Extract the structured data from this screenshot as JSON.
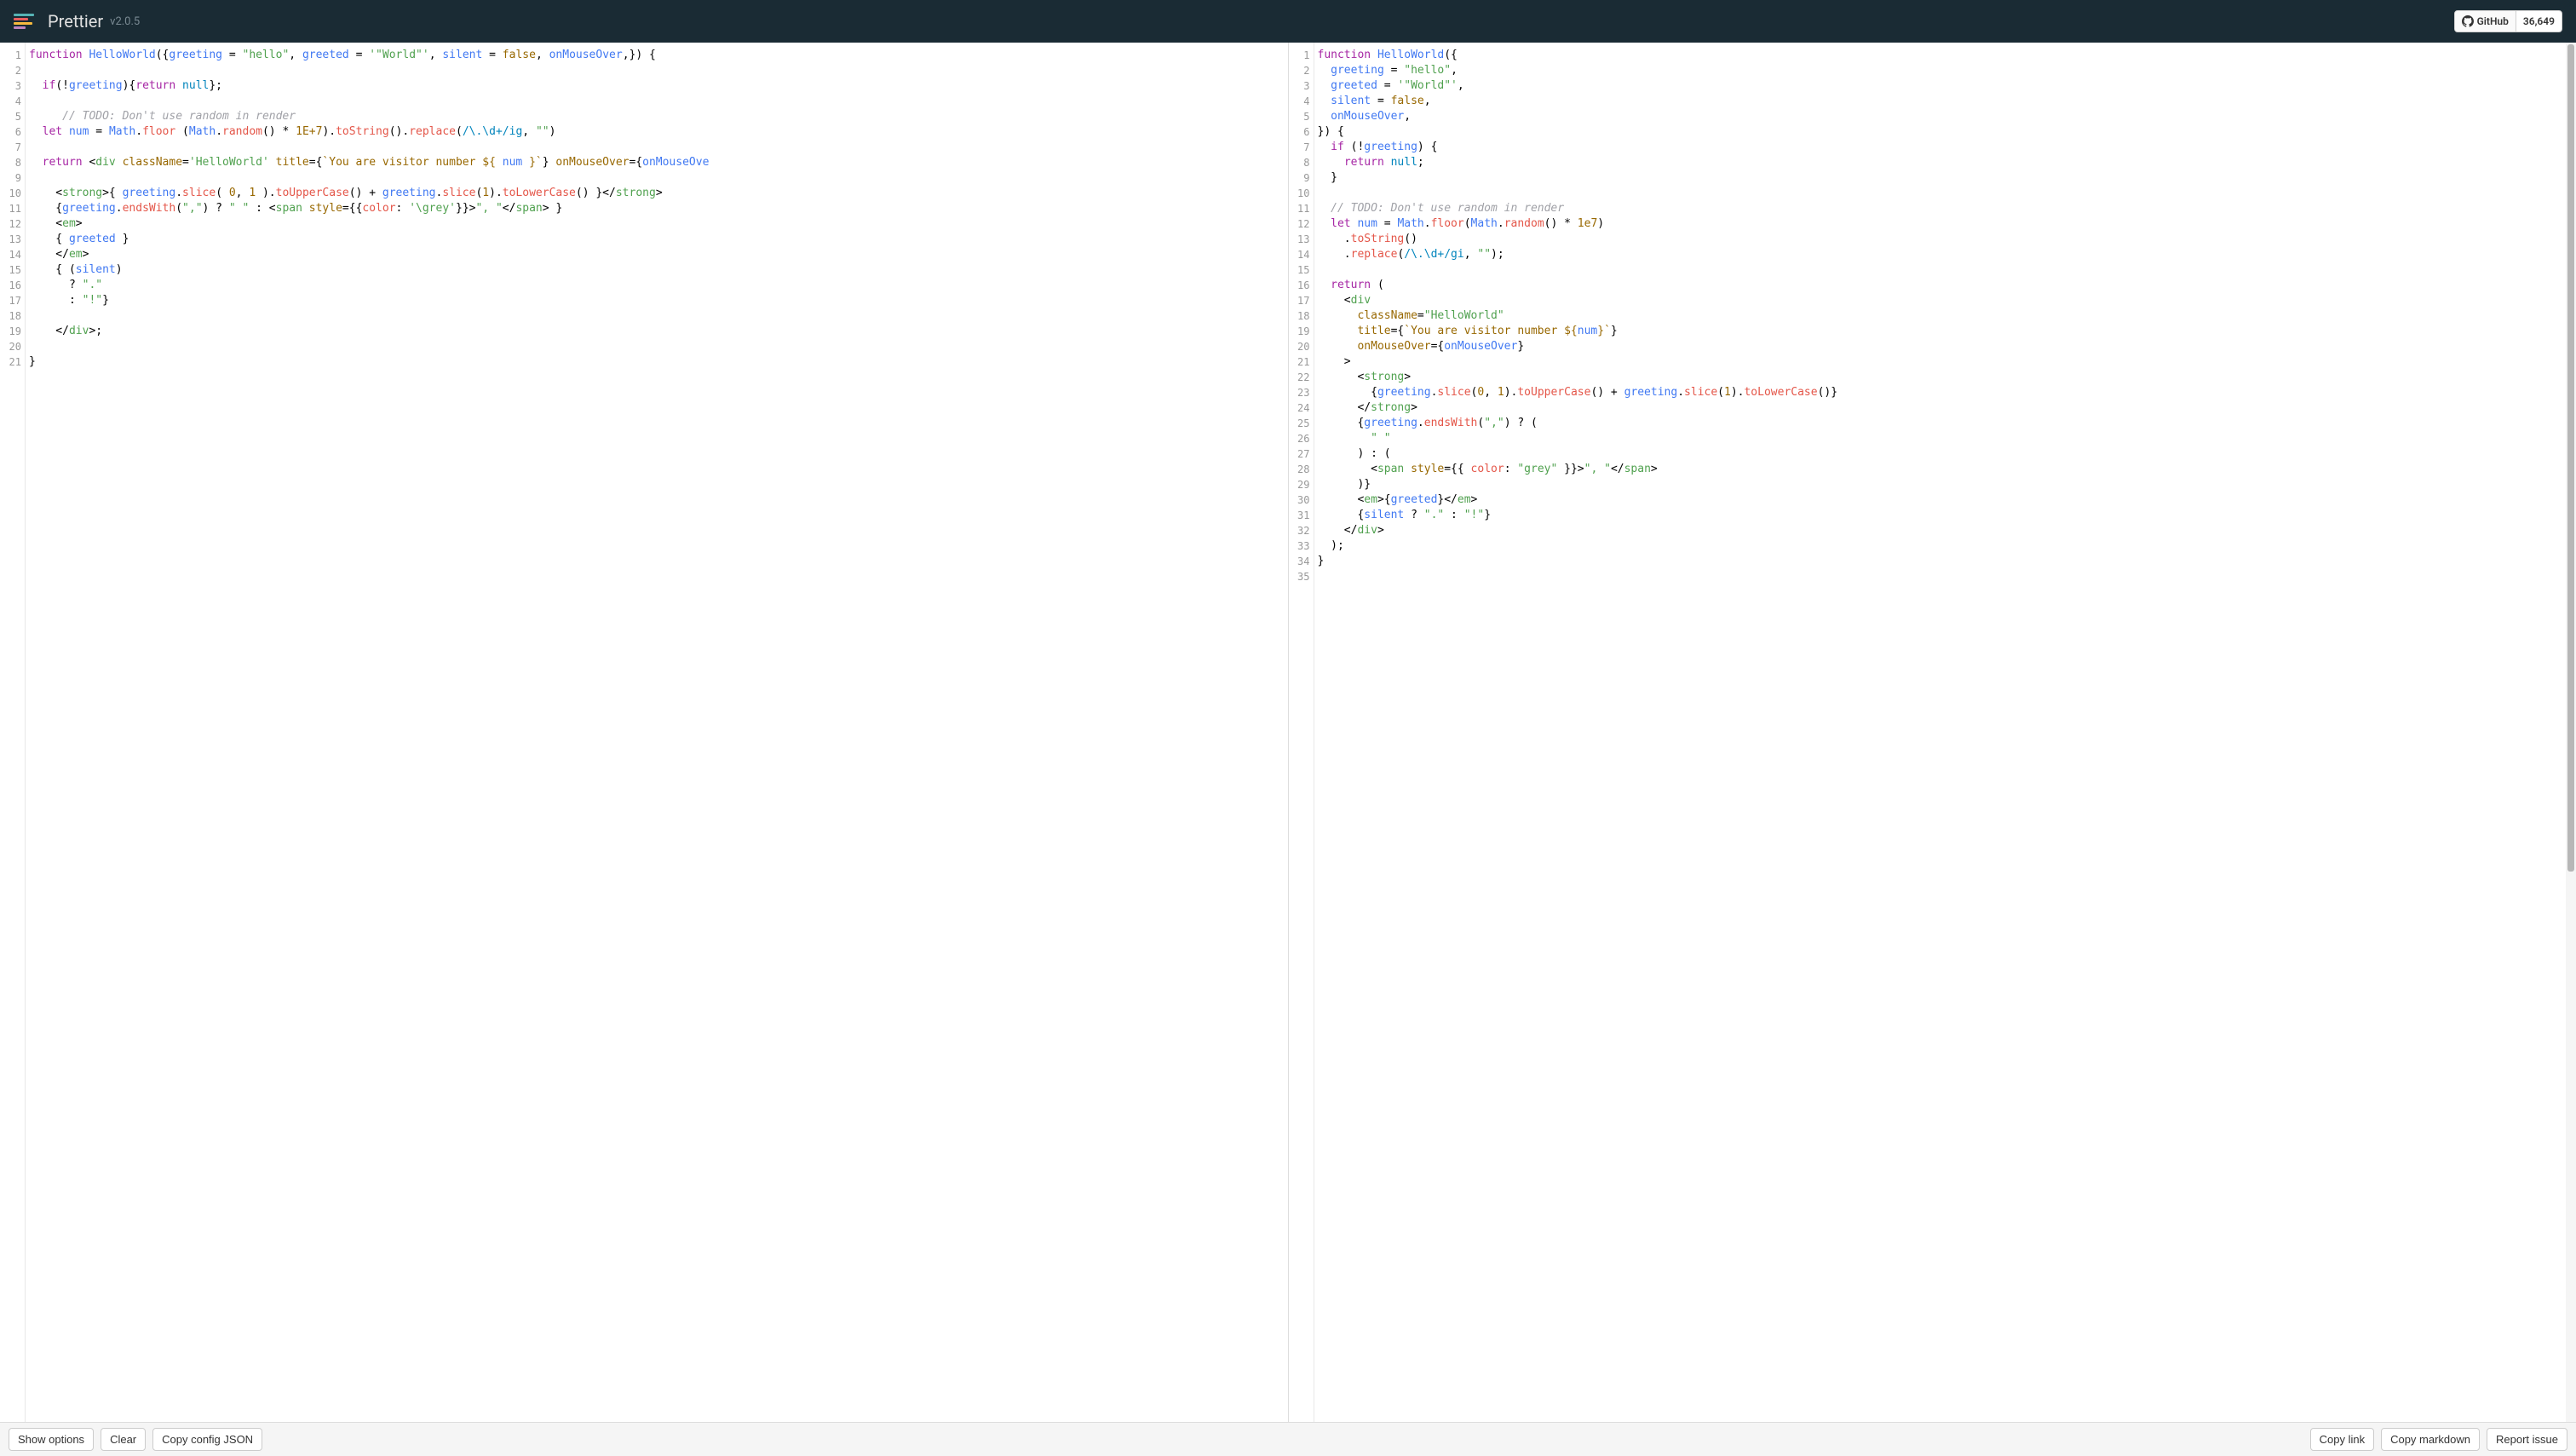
{
  "header": {
    "title": "Prettier",
    "version": "v2.0.5",
    "github_label": "GitHub",
    "github_stars": "36,649"
  },
  "editor": {
    "left_lines": 21,
    "right_lines": 35,
    "left_code": [
      [
        {
          "t": "function ",
          "c": "kw"
        },
        {
          "t": "HelloWorld",
          "c": "fn"
        },
        {
          "t": "({",
          "c": ""
        },
        {
          "t": "greeting",
          "c": "def"
        },
        {
          "t": " = ",
          "c": ""
        },
        {
          "t": "\"hello\"",
          "c": "str"
        },
        {
          "t": ", ",
          "c": ""
        },
        {
          "t": "greeted",
          "c": "def"
        },
        {
          "t": " = ",
          "c": ""
        },
        {
          "t": "'\"World\"'",
          "c": "str"
        },
        {
          "t": ", ",
          "c": ""
        },
        {
          "t": "silent",
          "c": "def"
        },
        {
          "t": " = ",
          "c": ""
        },
        {
          "t": "false",
          "c": "bool"
        },
        {
          "t": ", ",
          "c": ""
        },
        {
          "t": "onMouseOver",
          "c": "def"
        },
        {
          "t": ",}) {",
          "c": ""
        }
      ],
      [],
      [
        {
          "t": "  ",
          "c": ""
        },
        {
          "t": "if",
          "c": "kw"
        },
        {
          "t": "(!",
          "c": ""
        },
        {
          "t": "greeting",
          "c": "var2"
        },
        {
          "t": "){",
          "c": ""
        },
        {
          "t": "return ",
          "c": "kw"
        },
        {
          "t": "null",
          "c": "null"
        },
        {
          "t": "};",
          "c": ""
        }
      ],
      [],
      [
        {
          "t": "     ",
          "c": ""
        },
        {
          "t": "// TODO: Don't use random in render",
          "c": "com"
        }
      ],
      [
        {
          "t": "  ",
          "c": ""
        },
        {
          "t": "let ",
          "c": "kw"
        },
        {
          "t": "num",
          "c": "def"
        },
        {
          "t": " = ",
          "c": ""
        },
        {
          "t": "Math",
          "c": "var2"
        },
        {
          "t": ".",
          "c": ""
        },
        {
          "t": "floor",
          "c": "prop"
        },
        {
          "t": " (",
          "c": ""
        },
        {
          "t": "Math",
          "c": "var2"
        },
        {
          "t": ".",
          "c": ""
        },
        {
          "t": "random",
          "c": "prop"
        },
        {
          "t": "() * ",
          "c": ""
        },
        {
          "t": "1E+7",
          "c": "num"
        },
        {
          "t": ").",
          "c": ""
        },
        {
          "t": "toString",
          "c": "prop"
        },
        {
          "t": "().",
          "c": ""
        },
        {
          "t": "replace",
          "c": "prop"
        },
        {
          "t": "(",
          "c": ""
        },
        {
          "t": "/\\.\\d+/ig",
          "c": "reg"
        },
        {
          "t": ", ",
          "c": ""
        },
        {
          "t": "\"\"",
          "c": "str"
        },
        {
          "t": ")",
          "c": ""
        }
      ],
      [],
      [
        {
          "t": "  ",
          "c": ""
        },
        {
          "t": "return ",
          "c": "kw"
        },
        {
          "t": "<",
          "c": ""
        },
        {
          "t": "div",
          "c": "tag"
        },
        {
          "t": " ",
          "c": ""
        },
        {
          "t": "className",
          "c": "attr"
        },
        {
          "t": "=",
          "c": ""
        },
        {
          "t": "'HelloWorld'",
          "c": "str"
        },
        {
          "t": " ",
          "c": ""
        },
        {
          "t": "title",
          "c": "attr"
        },
        {
          "t": "={",
          "c": ""
        },
        {
          "t": "`You are visitor number ${",
          "c": "str2"
        },
        {
          "t": " num ",
          "c": "var2"
        },
        {
          "t": "}`",
          "c": "str2"
        },
        {
          "t": "} ",
          "c": ""
        },
        {
          "t": "onMouseOver",
          "c": "attr"
        },
        {
          "t": "={",
          "c": ""
        },
        {
          "t": "onMouseOve",
          "c": "var2"
        }
      ],
      [],
      [
        {
          "t": "    <",
          "c": ""
        },
        {
          "t": "strong",
          "c": "tag"
        },
        {
          "t": ">{ ",
          "c": ""
        },
        {
          "t": "greeting",
          "c": "var2"
        },
        {
          "t": ".",
          "c": ""
        },
        {
          "t": "slice",
          "c": "prop"
        },
        {
          "t": "( ",
          "c": ""
        },
        {
          "t": "0",
          "c": "num"
        },
        {
          "t": ", ",
          "c": ""
        },
        {
          "t": "1",
          "c": "num"
        },
        {
          "t": " ).",
          "c": ""
        },
        {
          "t": "toUpperCase",
          "c": "prop"
        },
        {
          "t": "() + ",
          "c": ""
        },
        {
          "t": "greeting",
          "c": "var2"
        },
        {
          "t": ".",
          "c": ""
        },
        {
          "t": "slice",
          "c": "prop"
        },
        {
          "t": "(",
          "c": ""
        },
        {
          "t": "1",
          "c": "num"
        },
        {
          "t": ").",
          "c": ""
        },
        {
          "t": "toLowerCase",
          "c": "prop"
        },
        {
          "t": "() }</",
          "c": ""
        },
        {
          "t": "strong",
          "c": "tag"
        },
        {
          "t": ">",
          "c": ""
        }
      ],
      [
        {
          "t": "    {",
          "c": ""
        },
        {
          "t": "greeting",
          "c": "var2"
        },
        {
          "t": ".",
          "c": ""
        },
        {
          "t": "endsWith",
          "c": "prop"
        },
        {
          "t": "(",
          "c": ""
        },
        {
          "t": "\",\"",
          "c": "str"
        },
        {
          "t": ") ? ",
          "c": ""
        },
        {
          "t": "\" \"",
          "c": "str"
        },
        {
          "t": " : <",
          "c": ""
        },
        {
          "t": "span",
          "c": "tag"
        },
        {
          "t": " ",
          "c": ""
        },
        {
          "t": "style",
          "c": "attr"
        },
        {
          "t": "={{",
          "c": ""
        },
        {
          "t": "color",
          "c": "prop"
        },
        {
          "t": ": ",
          "c": ""
        },
        {
          "t": "'\\grey'",
          "c": "str"
        },
        {
          "t": "}}>",
          "c": ""
        },
        {
          "t": "\", \"",
          "c": "str"
        },
        {
          "t": "</",
          "c": ""
        },
        {
          "t": "span",
          "c": "tag"
        },
        {
          "t": "> }",
          "c": ""
        }
      ],
      [
        {
          "t": "    <",
          "c": ""
        },
        {
          "t": "em",
          "c": "tag"
        },
        {
          "t": ">",
          "c": ""
        }
      ],
      [
        {
          "t": "    { ",
          "c": ""
        },
        {
          "t": "greeted",
          "c": "var2"
        },
        {
          "t": " }",
          "c": ""
        }
      ],
      [
        {
          "t": "    </",
          "c": ""
        },
        {
          "t": "em",
          "c": "tag"
        },
        {
          "t": ">",
          "c": ""
        }
      ],
      [
        {
          "t": "    { (",
          "c": ""
        },
        {
          "t": "silent",
          "c": "var2"
        },
        {
          "t": ")",
          "c": ""
        }
      ],
      [
        {
          "t": "      ? ",
          "c": ""
        },
        {
          "t": "\".\"",
          "c": "str"
        }
      ],
      [
        {
          "t": "      : ",
          "c": ""
        },
        {
          "t": "\"!\"",
          "c": "str"
        },
        {
          "t": "}",
          "c": ""
        }
      ],
      [],
      [
        {
          "t": "    </",
          "c": ""
        },
        {
          "t": "div",
          "c": "tag"
        },
        {
          "t": ">;",
          "c": ""
        }
      ],
      [],
      [
        {
          "t": "}",
          "c": ""
        }
      ]
    ],
    "right_code": [
      [
        {
          "t": "function ",
          "c": "kw"
        },
        {
          "t": "HelloWorld",
          "c": "fn"
        },
        {
          "t": "({",
          "c": ""
        }
      ],
      [
        {
          "t": "  ",
          "c": ""
        },
        {
          "t": "greeting",
          "c": "def"
        },
        {
          "t": " = ",
          "c": ""
        },
        {
          "t": "\"hello\"",
          "c": "str"
        },
        {
          "t": ",",
          "c": ""
        }
      ],
      [
        {
          "t": "  ",
          "c": ""
        },
        {
          "t": "greeted",
          "c": "def"
        },
        {
          "t": " = ",
          "c": ""
        },
        {
          "t": "'\"World\"'",
          "c": "str"
        },
        {
          "t": ",",
          "c": ""
        }
      ],
      [
        {
          "t": "  ",
          "c": ""
        },
        {
          "t": "silent",
          "c": "def"
        },
        {
          "t": " = ",
          "c": ""
        },
        {
          "t": "false",
          "c": "bool"
        },
        {
          "t": ",",
          "c": ""
        }
      ],
      [
        {
          "t": "  ",
          "c": ""
        },
        {
          "t": "onMouseOver",
          "c": "def"
        },
        {
          "t": ",",
          "c": ""
        }
      ],
      [
        {
          "t": "}) {",
          "c": ""
        }
      ],
      [
        {
          "t": "  ",
          "c": ""
        },
        {
          "t": "if ",
          "c": "kw"
        },
        {
          "t": "(!",
          "c": ""
        },
        {
          "t": "greeting",
          "c": "var2"
        },
        {
          "t": ") {",
          "c": ""
        }
      ],
      [
        {
          "t": "    ",
          "c": ""
        },
        {
          "t": "return ",
          "c": "kw"
        },
        {
          "t": "null",
          "c": "null"
        },
        {
          "t": ";",
          "c": ""
        }
      ],
      [
        {
          "t": "  }",
          "c": ""
        }
      ],
      [],
      [
        {
          "t": "  ",
          "c": ""
        },
        {
          "t": "// TODO: Don't use random in render",
          "c": "com"
        }
      ],
      [
        {
          "t": "  ",
          "c": ""
        },
        {
          "t": "let ",
          "c": "kw"
        },
        {
          "t": "num",
          "c": "def"
        },
        {
          "t": " = ",
          "c": ""
        },
        {
          "t": "Math",
          "c": "var2"
        },
        {
          "t": ".",
          "c": ""
        },
        {
          "t": "floor",
          "c": "prop"
        },
        {
          "t": "(",
          "c": ""
        },
        {
          "t": "Math",
          "c": "var2"
        },
        {
          "t": ".",
          "c": ""
        },
        {
          "t": "random",
          "c": "prop"
        },
        {
          "t": "() * ",
          "c": ""
        },
        {
          "t": "1e7",
          "c": "num"
        },
        {
          "t": ")",
          "c": ""
        }
      ],
      [
        {
          "t": "    .",
          "c": ""
        },
        {
          "t": "toString",
          "c": "prop"
        },
        {
          "t": "()",
          "c": ""
        }
      ],
      [
        {
          "t": "    .",
          "c": ""
        },
        {
          "t": "replace",
          "c": "prop"
        },
        {
          "t": "(",
          "c": ""
        },
        {
          "t": "/\\.\\d+/gi",
          "c": "reg"
        },
        {
          "t": ", ",
          "c": ""
        },
        {
          "t": "\"\"",
          "c": "str"
        },
        {
          "t": ");",
          "c": ""
        }
      ],
      [],
      [
        {
          "t": "  ",
          "c": ""
        },
        {
          "t": "return ",
          "c": "kw"
        },
        {
          "t": "(",
          "c": ""
        }
      ],
      [
        {
          "t": "    <",
          "c": ""
        },
        {
          "t": "div",
          "c": "tag"
        }
      ],
      [
        {
          "t": "      ",
          "c": ""
        },
        {
          "t": "className",
          "c": "attr"
        },
        {
          "t": "=",
          "c": ""
        },
        {
          "t": "\"HelloWorld\"",
          "c": "str"
        }
      ],
      [
        {
          "t": "      ",
          "c": ""
        },
        {
          "t": "title",
          "c": "attr"
        },
        {
          "t": "={",
          "c": ""
        },
        {
          "t": "`You are visitor number ${",
          "c": "str2"
        },
        {
          "t": "num",
          "c": "var2"
        },
        {
          "t": "}`",
          "c": "str2"
        },
        {
          "t": "}",
          "c": ""
        }
      ],
      [
        {
          "t": "      ",
          "c": ""
        },
        {
          "t": "onMouseOver",
          "c": "attr"
        },
        {
          "t": "={",
          "c": ""
        },
        {
          "t": "onMouseOver",
          "c": "var2"
        },
        {
          "t": "}",
          "c": ""
        }
      ],
      [
        {
          "t": "    >",
          "c": ""
        }
      ],
      [
        {
          "t": "      <",
          "c": ""
        },
        {
          "t": "strong",
          "c": "tag"
        },
        {
          "t": ">",
          "c": ""
        }
      ],
      [
        {
          "t": "        {",
          "c": ""
        },
        {
          "t": "greeting",
          "c": "var2"
        },
        {
          "t": ".",
          "c": ""
        },
        {
          "t": "slice",
          "c": "prop"
        },
        {
          "t": "(",
          "c": ""
        },
        {
          "t": "0",
          "c": "num"
        },
        {
          "t": ", ",
          "c": ""
        },
        {
          "t": "1",
          "c": "num"
        },
        {
          "t": ").",
          "c": ""
        },
        {
          "t": "toUpperCase",
          "c": "prop"
        },
        {
          "t": "() + ",
          "c": ""
        },
        {
          "t": "greeting",
          "c": "var2"
        },
        {
          "t": ".",
          "c": ""
        },
        {
          "t": "slice",
          "c": "prop"
        },
        {
          "t": "(",
          "c": ""
        },
        {
          "t": "1",
          "c": "num"
        },
        {
          "t": ").",
          "c": ""
        },
        {
          "t": "toLowerCase",
          "c": "prop"
        },
        {
          "t": "()}",
          "c": ""
        }
      ],
      [
        {
          "t": "      </",
          "c": ""
        },
        {
          "t": "strong",
          "c": "tag"
        },
        {
          "t": ">",
          "c": ""
        }
      ],
      [
        {
          "t": "      {",
          "c": ""
        },
        {
          "t": "greeting",
          "c": "var2"
        },
        {
          "t": ".",
          "c": ""
        },
        {
          "t": "endsWith",
          "c": "prop"
        },
        {
          "t": "(",
          "c": ""
        },
        {
          "t": "\",\"",
          "c": "str"
        },
        {
          "t": ") ? (",
          "c": ""
        }
      ],
      [
        {
          "t": "        ",
          "c": ""
        },
        {
          "t": "\" \"",
          "c": "str"
        }
      ],
      [
        {
          "t": "      ) : (",
          "c": ""
        }
      ],
      [
        {
          "t": "        <",
          "c": ""
        },
        {
          "t": "span",
          "c": "tag"
        },
        {
          "t": " ",
          "c": ""
        },
        {
          "t": "style",
          "c": "attr"
        },
        {
          "t": "={{ ",
          "c": ""
        },
        {
          "t": "color",
          "c": "prop"
        },
        {
          "t": ": ",
          "c": ""
        },
        {
          "t": "\"grey\"",
          "c": "str"
        },
        {
          "t": " }}>",
          "c": ""
        },
        {
          "t": "\", \"",
          "c": "str"
        },
        {
          "t": "</",
          "c": ""
        },
        {
          "t": "span",
          "c": "tag"
        },
        {
          "t": ">",
          "c": ""
        }
      ],
      [
        {
          "t": "      )}",
          "c": ""
        }
      ],
      [
        {
          "t": "      <",
          "c": ""
        },
        {
          "t": "em",
          "c": "tag"
        },
        {
          "t": ">{",
          "c": ""
        },
        {
          "t": "greeted",
          "c": "var2"
        },
        {
          "t": "}</",
          "c": ""
        },
        {
          "t": "em",
          "c": "tag"
        },
        {
          "t": ">",
          "c": ""
        }
      ],
      [
        {
          "t": "      {",
          "c": ""
        },
        {
          "t": "silent",
          "c": "var2"
        },
        {
          "t": " ? ",
          "c": ""
        },
        {
          "t": "\".\"",
          "c": "str"
        },
        {
          "t": " : ",
          "c": ""
        },
        {
          "t": "\"!\"",
          "c": "str"
        },
        {
          "t": "}",
          "c": ""
        }
      ],
      [
        {
          "t": "    </",
          "c": ""
        },
        {
          "t": "div",
          "c": "tag"
        },
        {
          "t": ">",
          "c": ""
        }
      ],
      [
        {
          "t": "  );",
          "c": ""
        }
      ],
      [
        {
          "t": "}",
          "c": ""
        }
      ],
      []
    ]
  },
  "footer": {
    "show_options": "Show options",
    "clear": "Clear",
    "copy_config": "Copy config JSON",
    "copy_link": "Copy link",
    "copy_markdown": "Copy markdown",
    "report_issue": "Report issue"
  }
}
